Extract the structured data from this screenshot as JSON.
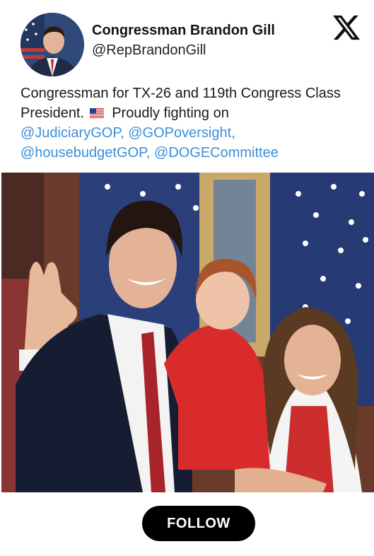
{
  "profile": {
    "display_name": "Congressman Brandon Gill",
    "handle": "@RepBrandonGill"
  },
  "bio": {
    "line_text_1": "Congressman for TX-26 and 119th Congress Class President.",
    "flag_icon": "us-flag-icon",
    "line_text_2": "Proudly fighting on",
    "mentions": [
      "@JudiciaryGOP",
      "@GOPoversight",
      "@housebudgetGOP",
      "@DOGECommittee"
    ],
    "sep_1": ", ",
    "sep_2": ",",
    "sep_3": ", "
  },
  "logo": {
    "icon": "x-logo-icon"
  },
  "follow": {
    "label": "FOLLOW"
  },
  "colors": {
    "accent": "#3b8fd9",
    "button_bg": "#000000",
    "button_text": "#ffffff"
  }
}
